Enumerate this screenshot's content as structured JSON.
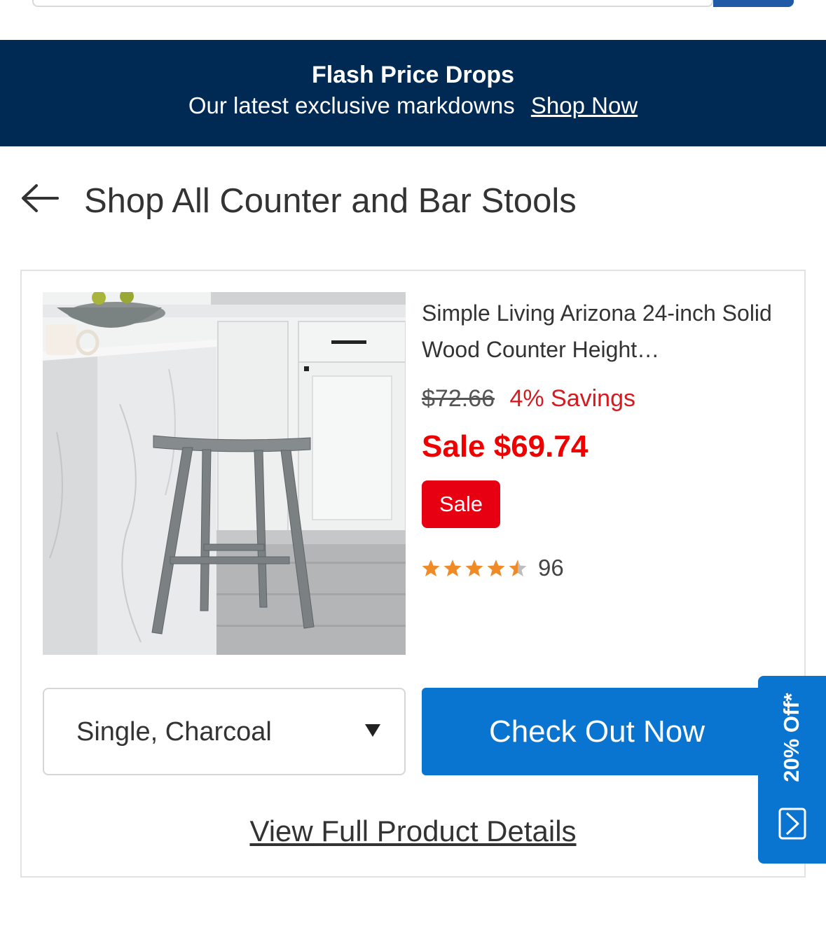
{
  "banner": {
    "title": "Flash Price Drops",
    "subtitle": "Our latest exclusive markdowns",
    "link": "Shop Now"
  },
  "back": {
    "icon": "arrow-left-icon",
    "title": "Shop All Counter and Bar Stools"
  },
  "product": {
    "name": "Simple Living Arizona 24-inch Solid Wood Counter Height…",
    "original_price": "$72.66",
    "savings": "4% Savings",
    "sale_price": "Sale $69.74",
    "badge": "Sale",
    "rating": 4.5,
    "review_count": "96",
    "variant": "Single, Charcoal",
    "checkout_label": "Check Out Now",
    "details_link": "View Full Product Details"
  },
  "side_tab": {
    "label": "20% Off*",
    "icon": "coupon-icon"
  },
  "colors": {
    "banner_bg": "#002a54",
    "accent_blue": "#0a75d1",
    "sale_red": "#e60012",
    "star": "#f08a24"
  }
}
